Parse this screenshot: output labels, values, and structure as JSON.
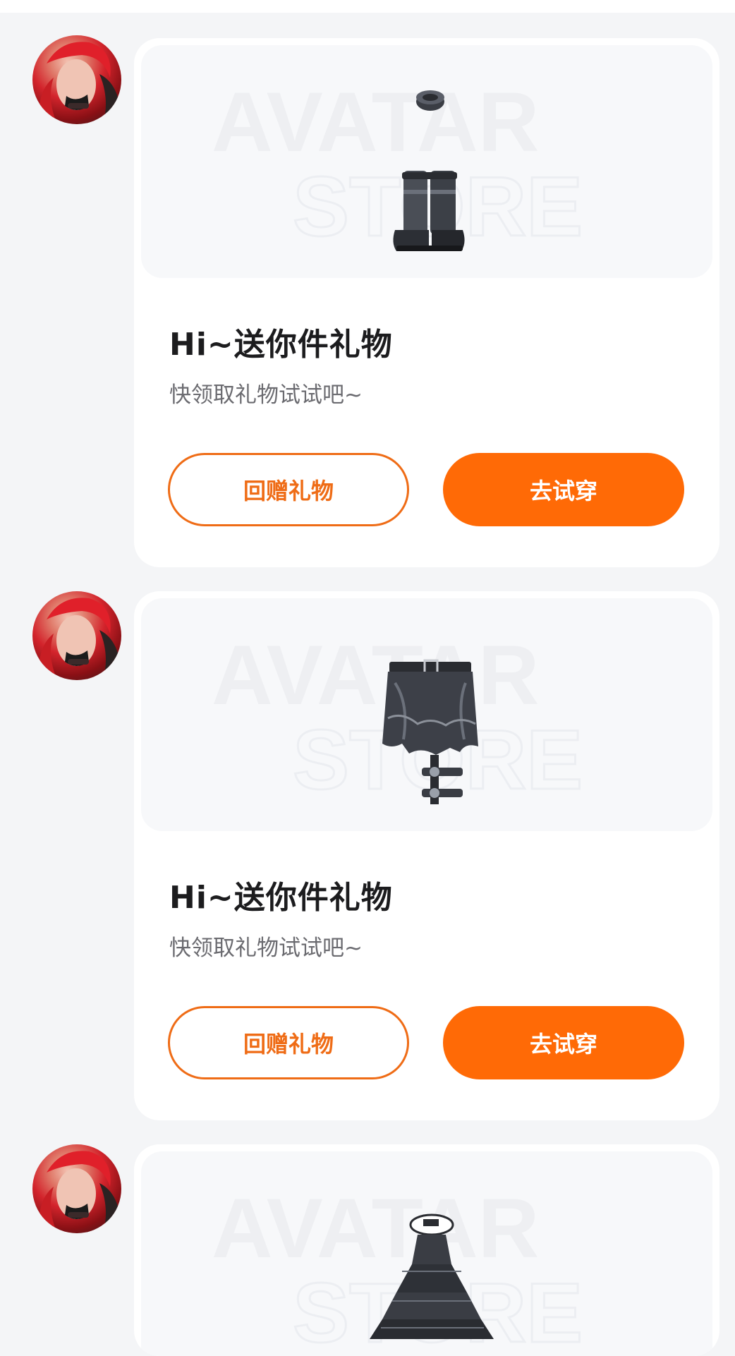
{
  "watermark": {
    "line1": "AVATAR",
    "line2": "STORE"
  },
  "colors": {
    "background": "#f4f5f7",
    "card": "#ffffff",
    "accent": "#ff6a06",
    "title": "#1c1c1e",
    "subtitle": "#6b6b70"
  },
  "messages": [
    {
      "item_icon": "boots-icon",
      "title": "Hi~送你件礼物",
      "subtitle": "快领取礼物试试吧~",
      "return_gift_label": "回赠礼物",
      "try_on_label": "去试穿"
    },
    {
      "item_icon": "shorts-icon",
      "title": "Hi~送你件礼物",
      "subtitle": "快领取礼物试试吧~",
      "return_gift_label": "回赠礼物",
      "try_on_label": "去试穿"
    },
    {
      "item_icon": "dress-icon"
    }
  ]
}
